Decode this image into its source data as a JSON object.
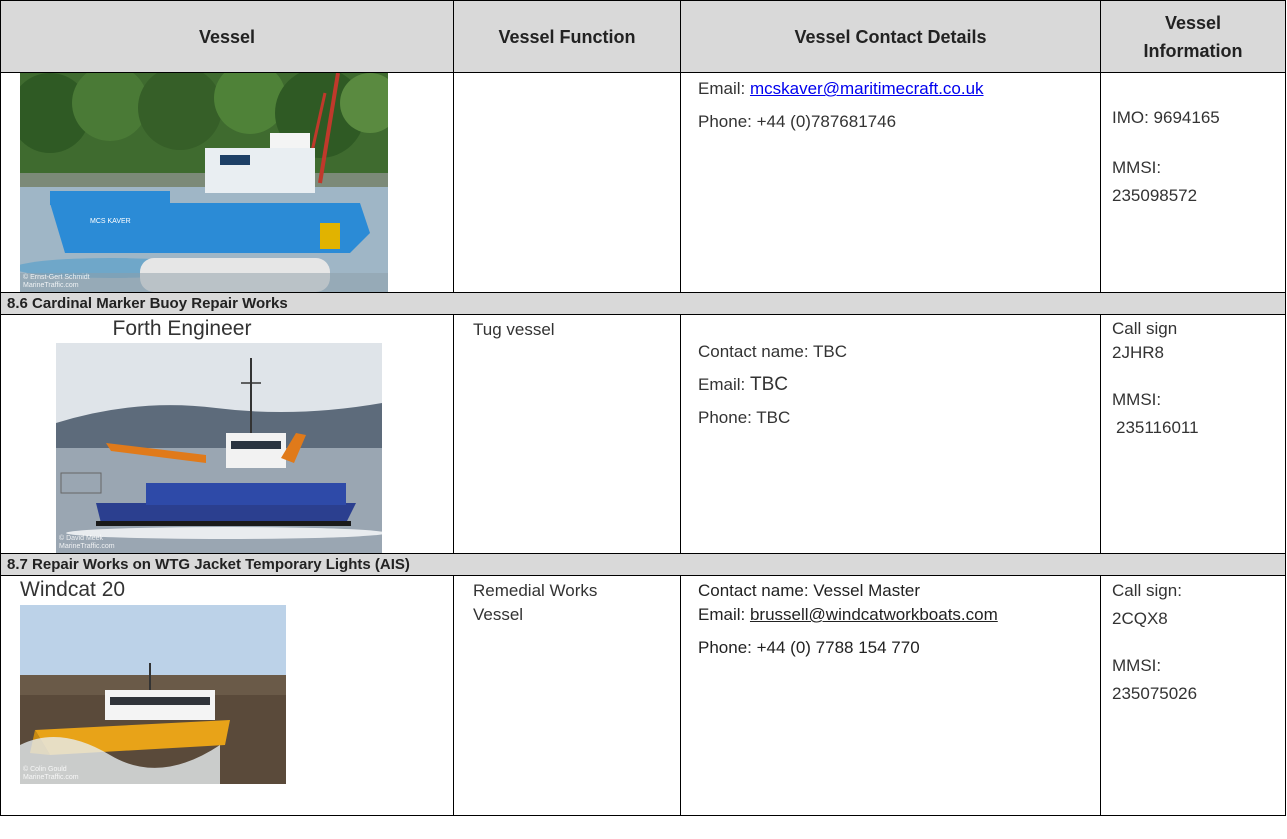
{
  "headers": {
    "vessel": "Vessel",
    "function": "Vessel Function",
    "contact": "Vessel Contact Details",
    "info": "Vessel Information"
  },
  "row1": {
    "email_label": "Email: ",
    "email": "mcskaver@maritimecraft.co.uk",
    "phone": "Phone: +44 (0)787681746",
    "imo": "IMO: 9694165",
    "mmsi_label": "MMSI:",
    "mmsi": "235098572",
    "photo_credit": "© Ernst-Gert Schmidt",
    "photo_site": "MarineTraffic.com",
    "hull_text": "MCS KAVER"
  },
  "section1": "8.6 Cardinal Marker Buoy Repair Works",
  "row2": {
    "vessel_name": "Forth Engineer",
    "function": "Tug vessel",
    "contact_name": "Contact name: TBC",
    "email_label": "Email: ",
    "email": "TBC",
    "phone": "Phone: TBC",
    "callsign_label": "Call sign",
    "callsign": "2JHR8",
    "mmsi_label": "MMSI:",
    "mmsi": "235116011",
    "photo_credit": "© David Meek",
    "photo_site": "MarineTraffic.com"
  },
  "section2": "8.7 Repair Works on WTG Jacket Temporary Lights (AIS)",
  "row3": {
    "vessel_name": "Windcat 20",
    "function_line1": "Remedial Works",
    "function_line2": "Vessel",
    "contact_name": "Contact name: Vessel Master",
    "email_label": "Email: ",
    "email": "brussell@windcatworkboats.com",
    "phone": "Phone: +44 (0) 7788 154 770",
    "callsign_label": "Call sign:",
    "callsign": "2CQX8",
    "mmsi_label": "MMSI:",
    "mmsi": "235075026",
    "photo_credit": "© Colin Gould",
    "photo_site": "MarineTraffic.com"
  }
}
